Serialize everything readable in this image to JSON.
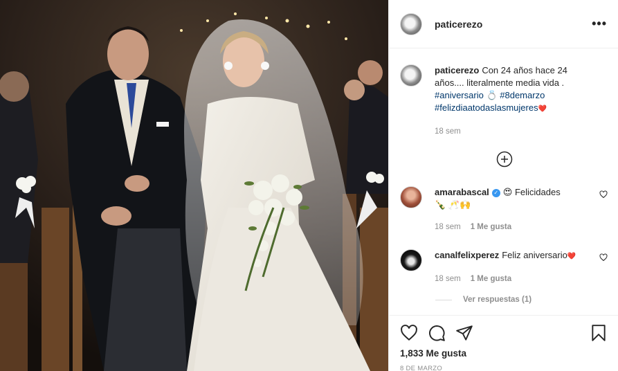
{
  "post": {
    "username": "paticerezo",
    "caption": {
      "username": "paticerezo",
      "text": "Con 24 años hace 24 años.... literalmente media vida .",
      "tags": [
        "#aniversario",
        "#8demarzo",
        "#felizdiaatodaslasmujeres"
      ],
      "ring_emoji": "💍",
      "heart_emoji": "❤️",
      "time": "18 sem"
    },
    "comments": [
      {
        "username": "amarabascal",
        "verified": true,
        "text": "😍 Felicidades",
        "text2": "🍾 🥂🙌",
        "time": "18 sem",
        "likes": "1 Me gusta"
      },
      {
        "username": "canalfelixperez",
        "text": "Feliz aniversario",
        "heart_emoji": "❤️",
        "time": "18 sem",
        "likes": "1 Me gusta"
      }
    ],
    "view_replies": "Ver respuestas (1)",
    "like_count": "1,833 Me gusta",
    "date": "8 DE MARZO",
    "icons": [
      "more-options-icon",
      "load-more-comments-icon",
      "like-heart-icon",
      "comment-icon",
      "share-icon",
      "save-bookmark-icon"
    ]
  }
}
